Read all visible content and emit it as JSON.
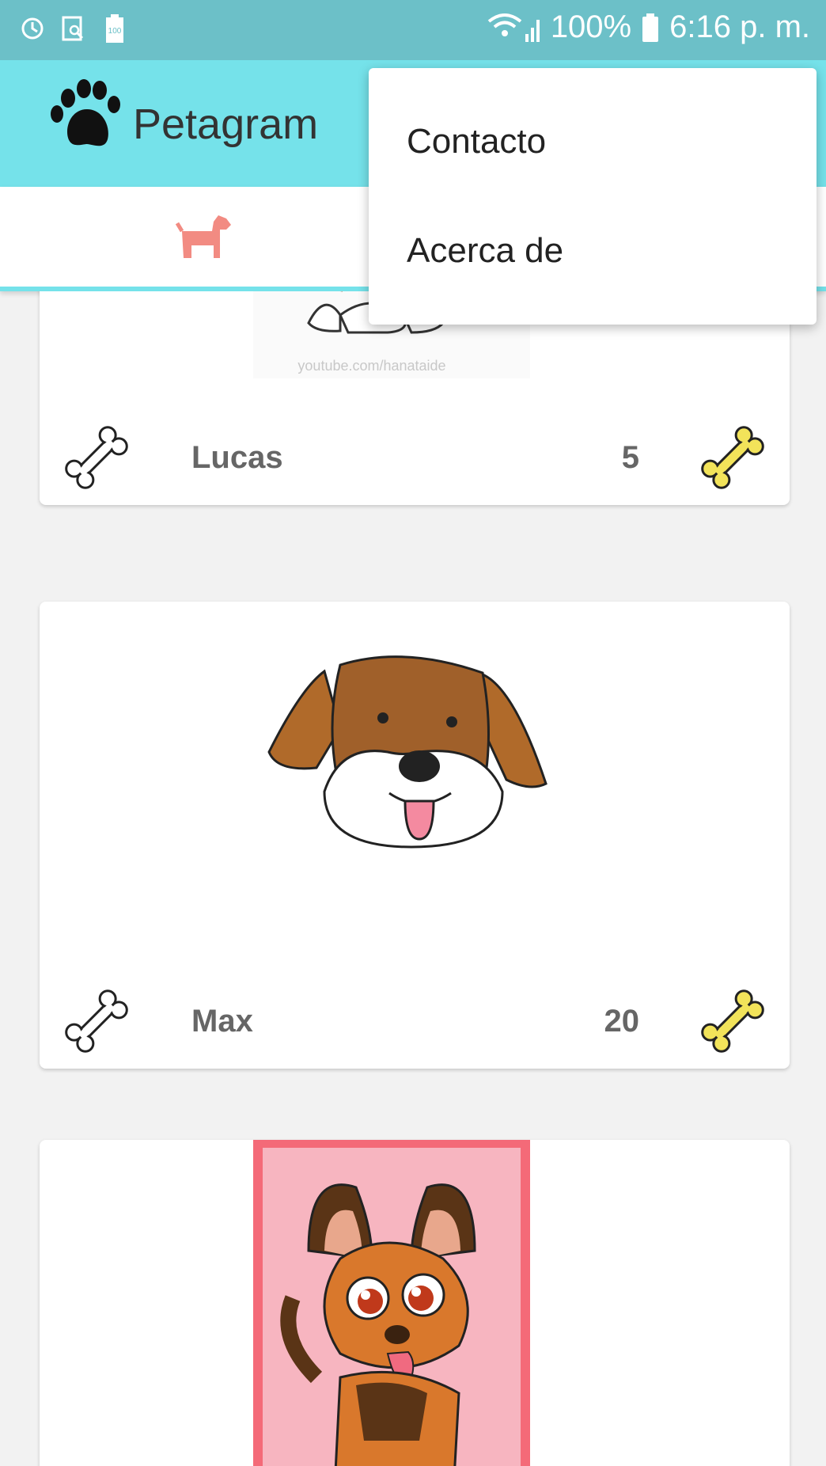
{
  "status_bar": {
    "battery_percent": "100%",
    "time": "6:16 p. m.",
    "battery_badge": "100",
    "icons": [
      "sync-icon",
      "screenshot-icon",
      "battery-saver-icon",
      "wifi-icon",
      "signal-icon",
      "battery-icon"
    ]
  },
  "toolbar": {
    "app_title": "Petagram",
    "logo_icon": "paw-icon"
  },
  "tabs": {
    "active_icon": "dog-icon",
    "active_color": "#f28b82"
  },
  "pets": [
    {
      "name": "Lucas",
      "likes": "5"
    },
    {
      "name": "Max",
      "likes": "20"
    },
    {
      "name": "",
      "likes": ""
    }
  ],
  "image_watermark": "youtube.com/hanataide",
  "overflow_menu": {
    "items": [
      {
        "label": "Contacto"
      },
      {
        "label": "Acerca de"
      }
    ]
  },
  "colors": {
    "status_bar": "#6cc0c8",
    "toolbar": "#75e2ea",
    "like_bone": "#f2e35a"
  }
}
